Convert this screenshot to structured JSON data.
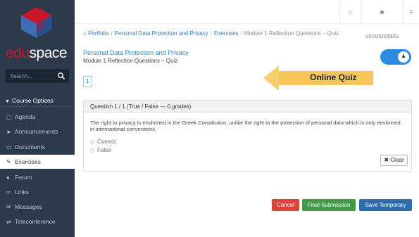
{
  "brand": {
    "part1": "edu",
    "part2": "space"
  },
  "search": {
    "placeholder": "Search..."
  },
  "sidebar": {
    "section_label": "Course Options",
    "items": [
      {
        "label": "Agenda",
        "icon": "calendar-icon"
      },
      {
        "label": "Announcements",
        "icon": "megaphone-icon"
      },
      {
        "label": "Documents",
        "icon": "folder-icon"
      },
      {
        "label": "Exercises",
        "icon": "edit-icon",
        "active": true
      },
      {
        "label": "Forum",
        "icon": "comments-icon"
      },
      {
        "label": "Links",
        "icon": "link-icon"
      },
      {
        "label": "Messages",
        "icon": "envelope-icon"
      },
      {
        "label": "Teleconference",
        "icon": "exchange-icon"
      }
    ]
  },
  "topbar": {
    "username": "simosretalis"
  },
  "breadcrumb": {
    "items": [
      "Portfolio",
      "Personal Data Protection and Privacy",
      "Exercises"
    ],
    "current": "Module 1 Reflection Questions – Quiz"
  },
  "page": {
    "course_title": "Personal Data Protection and Privacy",
    "quiz_title": "Module 1 Reflection Questions – Quiz",
    "current_page": "1"
  },
  "callout": {
    "text": "Online Quiz"
  },
  "question": {
    "header": "Question 1 / 1 (True / False — 0 grades)",
    "text": "The right to privacy is enshrined in the Greek Constitution, unlike the right to the protection of personal data which is only enshrined in international conventions.",
    "options": [
      "Correct",
      "False"
    ],
    "clear_label": "Clear"
  },
  "actions": {
    "cancel": "Cancel",
    "final_submission": "Final Submission",
    "save_temporary": "Save Temporary"
  },
  "colors": {
    "sidebar_bg": "#2c3a4b",
    "brand_red": "#c8172d",
    "link_blue": "#2a7bbf",
    "toggle_blue": "#2c8be0",
    "callout_yellow": "#f7cf6e",
    "cancel_red": "#d8433a",
    "final_green": "#3f9b48",
    "save_blue": "#2c6db1"
  }
}
